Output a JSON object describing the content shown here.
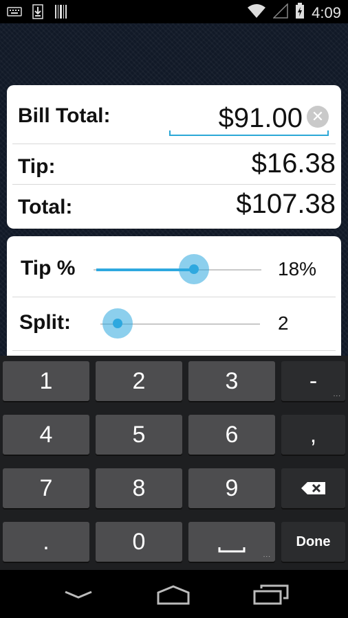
{
  "status_bar": {
    "time": "4:09",
    "icons": [
      "keyboard-icon",
      "download-icon",
      "barcode-icon",
      "wifi-icon",
      "signal-icon",
      "battery-charging-icon"
    ]
  },
  "bill": {
    "label": "Bill Total:",
    "value": "$91.00",
    "clear_icon": "clear-icon"
  },
  "tip": {
    "label": "Tip:",
    "value": "$16.38"
  },
  "total": {
    "label": "Total:",
    "value": "$107.38"
  },
  "tip_percent": {
    "label": "Tip %",
    "value": "18%",
    "slider_level": 0.6
  },
  "split": {
    "label": "Split:",
    "value": "2",
    "slider_level": 0.05
  },
  "keyboard": {
    "rows": [
      [
        "1",
        "2",
        "3",
        "-"
      ],
      [
        "4",
        "5",
        "6",
        ","
      ],
      [
        "7",
        "8",
        "9",
        "⌫"
      ],
      [
        ".",
        "0",
        "␣",
        "Done"
      ]
    ],
    "done_label": "Done"
  },
  "nav": {
    "icons": [
      "back-icon",
      "home-icon",
      "recents-icon"
    ]
  },
  "colors": {
    "accent": "#2ea8df",
    "key_bg": "#4d4d4f",
    "keyboard_bg": "#1e1f21"
  }
}
